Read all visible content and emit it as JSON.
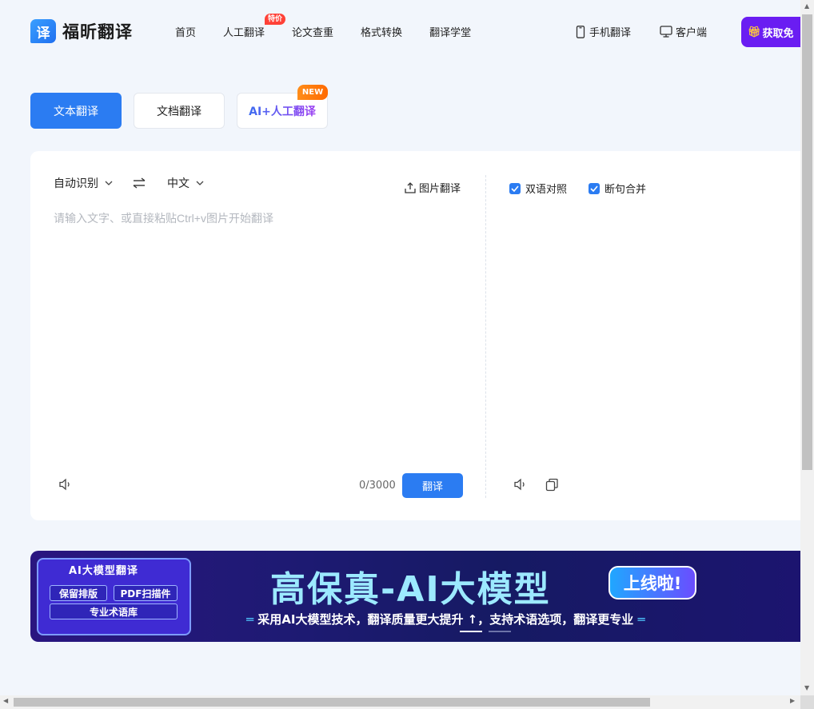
{
  "brand": {
    "logo_glyph": "译",
    "name": "福昕翻译"
  },
  "nav": {
    "items": [
      "首页",
      "人工翻译",
      "论文查重",
      "格式转换",
      "翻译学堂"
    ],
    "hot_badge": "特价"
  },
  "header_right": {
    "mobile": "手机翻译",
    "client": "客户端",
    "free_button": "获取免",
    "free_icon": "gift-icon"
  },
  "modes": {
    "text": "文本翻译",
    "document": "文档翻译",
    "ai_human": "AI+人工翻译",
    "new_badge": "NEW"
  },
  "translator": {
    "source_lang": "自动识别",
    "target_lang": "中文",
    "image_translate": "图片翻译",
    "placeholder": "请输入文字、或直接粘贴Ctrl+v图片开始翻译",
    "char_count": "0/3000",
    "translate_button": "翻译",
    "options": [
      {
        "label": "双语对照",
        "checked": true
      },
      {
        "label": "断句合并",
        "checked": true
      }
    ]
  },
  "banner": {
    "left_title": "AI大模型翻译",
    "features": [
      "保留排版",
      "PDF扫描件",
      "专业术语库"
    ],
    "headline": "高保真-AI大模型",
    "online_badge": "上线啦!",
    "subtitle": "采用AI大模型技术，翻译质量更大提升 ↑，支持术语选项，翻译更专业",
    "slides_total": 2,
    "active_slide": 1
  },
  "colors": {
    "primary": "#2b7cf2",
    "accent_purple": "#6a1df2",
    "hot_red": "#ff4137",
    "new_orange": "#ff7a0d",
    "page_bg": "#f2f6fc"
  }
}
